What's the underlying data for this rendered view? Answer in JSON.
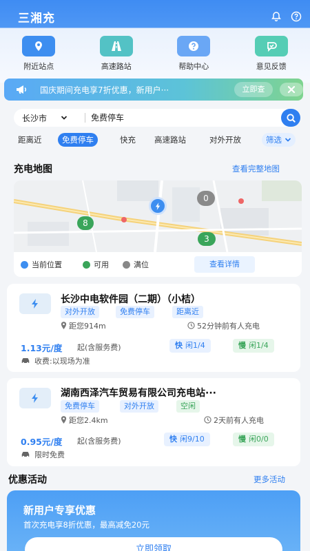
{
  "header": {
    "app_title": "三湘充"
  },
  "shortcuts": [
    {
      "label": "附近站点",
      "icon": "location-pin-icon",
      "color": "#3d8ef0"
    },
    {
      "label": "高速路站",
      "icon": "highway-icon",
      "color": "#53c2c5"
    },
    {
      "label": "帮助中心",
      "icon": "help-icon",
      "color": "#6aa7f5"
    },
    {
      "label": "意见反馈",
      "icon": "feedback-icon",
      "color": "#55cdb5"
    }
  ],
  "promo": {
    "text": "国庆期间充电享7折优惠，新用户···",
    "button": "立即查"
  },
  "search": {
    "city": "长沙市",
    "query": "免费停车"
  },
  "filters": [
    {
      "label": "距离近",
      "active": false
    },
    {
      "label": "免费停车",
      "active": true
    },
    {
      "label": "快充",
      "active": false
    },
    {
      "label": "高速路站",
      "active": false
    },
    {
      "label": "对外开放",
      "active": false
    },
    {
      "label": "筛选",
      "active": false
    }
  ],
  "map_section": {
    "title": "充电地图",
    "link": "查看完整地图",
    "markers": [
      "0",
      "8",
      "3"
    ],
    "legend": [
      "当前位置",
      "可用",
      "满位"
    ],
    "detail_button": "查看详情",
    "colors": {
      "current": "#3d8ef0",
      "available": "#3aa55a",
      "full": "#888888"
    }
  },
  "stations": [
    {
      "name": "长沙中电软件园（二期）（小桔）",
      "tags": [
        "对外开放",
        "免费停车",
        "距离近"
      ],
      "distance": "距您914m",
      "last_charge": "52分钟前有人充电",
      "price": "1.13元/度",
      "price_note": "起(含服务费)",
      "fast_label": "快",
      "fast_status": "闲1/4",
      "slow_label": "慢",
      "slow_status": "闲1/4",
      "fee": "收费:以现场为准"
    },
    {
      "name": "湖南西泽汽车贸易有限公司充电站···",
      "tags": [
        "免费停车",
        "对外开放",
        "空闲"
      ],
      "distance": "距您2.4km",
      "last_charge": "2天前有人充电",
      "price": "0.95元/度",
      "price_note": "起(含服务费)",
      "fast_label": "快",
      "fast_status": "闲9/10",
      "slow_label": "慢",
      "slow_status": "闲0/0",
      "fee": "限时免费"
    }
  ],
  "activity": {
    "title": "优惠活动",
    "link": "更多活动",
    "card_title": "新用户专享优惠",
    "card_sub": "首次充电享8折优惠，最高减免20元",
    "card_button": "立即领取"
  }
}
